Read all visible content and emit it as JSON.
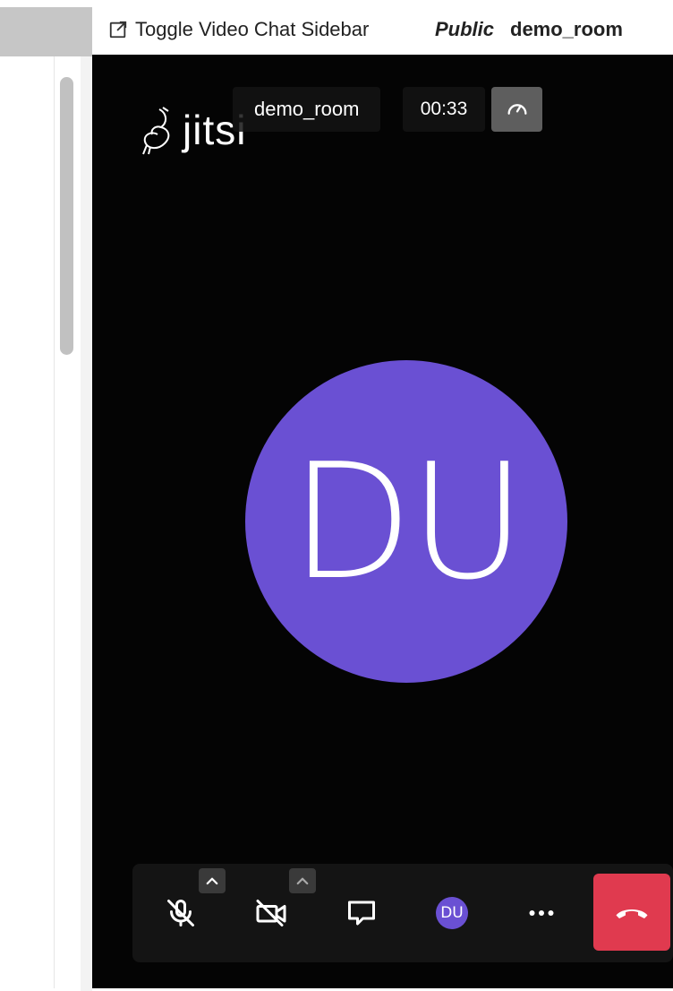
{
  "topbar": {
    "toggle_label": "Toggle Video Chat Sidebar",
    "privacy": "Public",
    "room_name": "demo_room"
  },
  "video": {
    "logo_text": "jitsi",
    "subject": "demo_room",
    "timer": "00:33",
    "participant_initials": "DU",
    "avatar_color": "#6a50d3"
  },
  "toolbar": {
    "buttons": [
      {
        "name": "microphone",
        "icon": "mic-muted-icon"
      },
      {
        "name": "camera",
        "icon": "camera-off-icon"
      },
      {
        "name": "chat",
        "icon": "chat-icon"
      },
      {
        "name": "participants",
        "icon": "avatar"
      },
      {
        "name": "more",
        "icon": "more-icon"
      },
      {
        "name": "leave",
        "icon": "hangup-icon"
      }
    ],
    "avatar_initials": "DU",
    "hangup_color": "#e03a4f"
  }
}
